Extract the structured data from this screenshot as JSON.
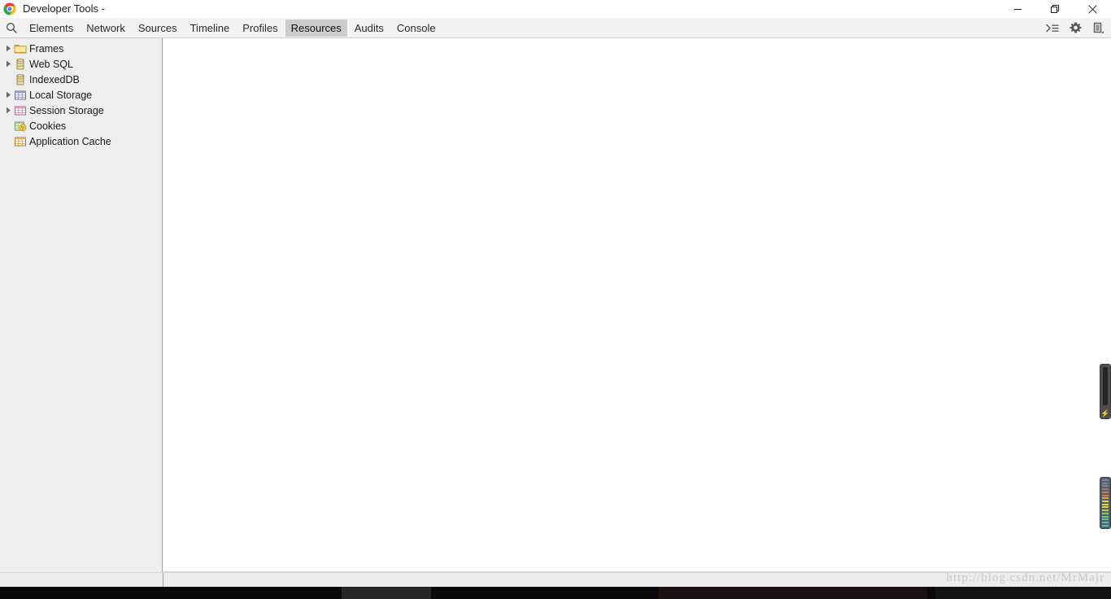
{
  "window": {
    "title": "Developer Tools -",
    "logo_icon": "chrome-logo-icon",
    "controls": [
      {
        "name": "minimize",
        "icon": "minimize-icon",
        "label": "—"
      },
      {
        "name": "maximize",
        "icon": "restore-icon",
        "label": "❐"
      },
      {
        "name": "close",
        "icon": "close-icon",
        "label": "✕"
      }
    ]
  },
  "tabbar": {
    "search_icon": "search-icon",
    "tabs": [
      {
        "label": "Elements",
        "selected": false
      },
      {
        "label": "Network",
        "selected": false
      },
      {
        "label": "Sources",
        "selected": false
      },
      {
        "label": "Timeline",
        "selected": false
      },
      {
        "label": "Profiles",
        "selected": false
      },
      {
        "label": "Resources",
        "selected": true
      },
      {
        "label": "Audits",
        "selected": false
      },
      {
        "label": "Console",
        "selected": false
      }
    ],
    "right_buttons": [
      {
        "name": "toggle-drawer-button",
        "icon": "console-drawer-icon"
      },
      {
        "name": "settings-button",
        "icon": "gear-icon"
      },
      {
        "name": "dock-side-button",
        "icon": "dock-icon"
      }
    ]
  },
  "sidebar": {
    "items": [
      {
        "label": "Frames",
        "icon": "folder-icon",
        "expandable": true
      },
      {
        "label": "Web SQL",
        "icon": "database-icon",
        "expandable": true
      },
      {
        "label": "IndexedDB",
        "icon": "database-icon",
        "expandable": false
      },
      {
        "label": "Local Storage",
        "icon": "table-blue-icon",
        "expandable": true
      },
      {
        "label": "Session Storage",
        "icon": "table-pink-icon",
        "expandable": true
      },
      {
        "label": "Cookies",
        "icon": "cookies-icon",
        "expandable": false
      },
      {
        "label": "Application Cache",
        "icon": "table-orange-icon",
        "expandable": false
      }
    ]
  },
  "main": {
    "content": ""
  },
  "footer": {
    "watermark": "http://blog.csdn.net/MrMajr"
  },
  "gadgets": [
    {
      "name": "battery-gadget",
      "icon": "battery-charging-icon",
      "bolt": "⚡"
    },
    {
      "name": "signal-meter-gadget",
      "icon": "level-meter-icon"
    }
  ],
  "colors": {
    "sidebar_bg": "#eeeeee",
    "main_bg": "#ffffff",
    "tabbar_bg": "#f3f3f3",
    "tab_selected_bg": "#cccccc",
    "divider": "#a0a0a0",
    "watermark_text": "#c9c9c9"
  },
  "meter_levels": [
    "#7f8796",
    "#7f8796",
    "#7f8796",
    "#7f8796",
    "#e07a3a",
    "#e07a3a",
    "#e0a83a",
    "#ddd447",
    "#ddd447",
    "#ddd447",
    "#b6d24a",
    "#8ece55",
    "#6fd06a",
    "#58cb8b",
    "#4ec6a6",
    "#4ec0bb"
  ]
}
